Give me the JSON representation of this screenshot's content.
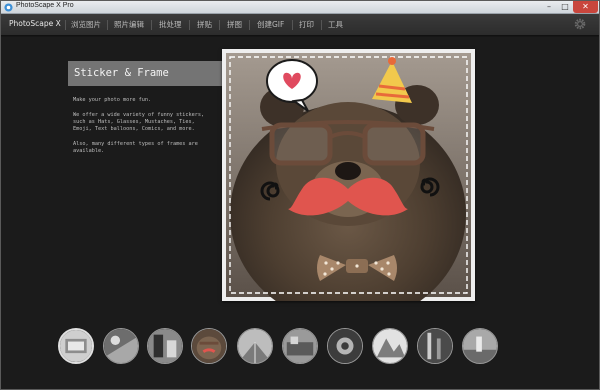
{
  "window": {
    "title": "PhotoScape X Pro",
    "controls": {
      "minimize": "–",
      "maximize": "□",
      "close": "✕"
    }
  },
  "menu": {
    "items": [
      {
        "label": "PhotoScape X",
        "active": true
      },
      {
        "label": "浏览图片",
        "active": false
      },
      {
        "label": "照片编辑",
        "active": false
      },
      {
        "label": "批处理",
        "active": false
      },
      {
        "label": "拼贴",
        "active": false
      },
      {
        "label": "拼图",
        "active": false
      },
      {
        "label": "创建GIF",
        "active": false
      },
      {
        "label": "打印",
        "active": false
      },
      {
        "label": "工具",
        "active": false
      }
    ],
    "settings_icon": "gear-icon"
  },
  "feature": {
    "title": "Sticker & Frame",
    "description": [
      "Make your photo more fun.",
      "We offer a wide variety of funny stickers,\nsuch as Hats, Glasses, Mustaches, Ties,\nEmoji, Text balloons, Comics, and more.",
      "Also, many different types of frames are\navailable."
    ]
  },
  "preview": {
    "stickers": [
      "heart-speech-bubble-icon",
      "party-hat-icon",
      "glasses-icon",
      "swirl-icon",
      "mustache-icon",
      "bow-tie-icon"
    ]
  },
  "thumbnails": {
    "count": 10,
    "selected_index": 0
  },
  "colors": {
    "background": "#1b1b1b",
    "menubar": "#2f2f2f",
    "mustache": "#e0554e",
    "hat": "#f2c94c",
    "bow_tie": "#a8876a"
  }
}
